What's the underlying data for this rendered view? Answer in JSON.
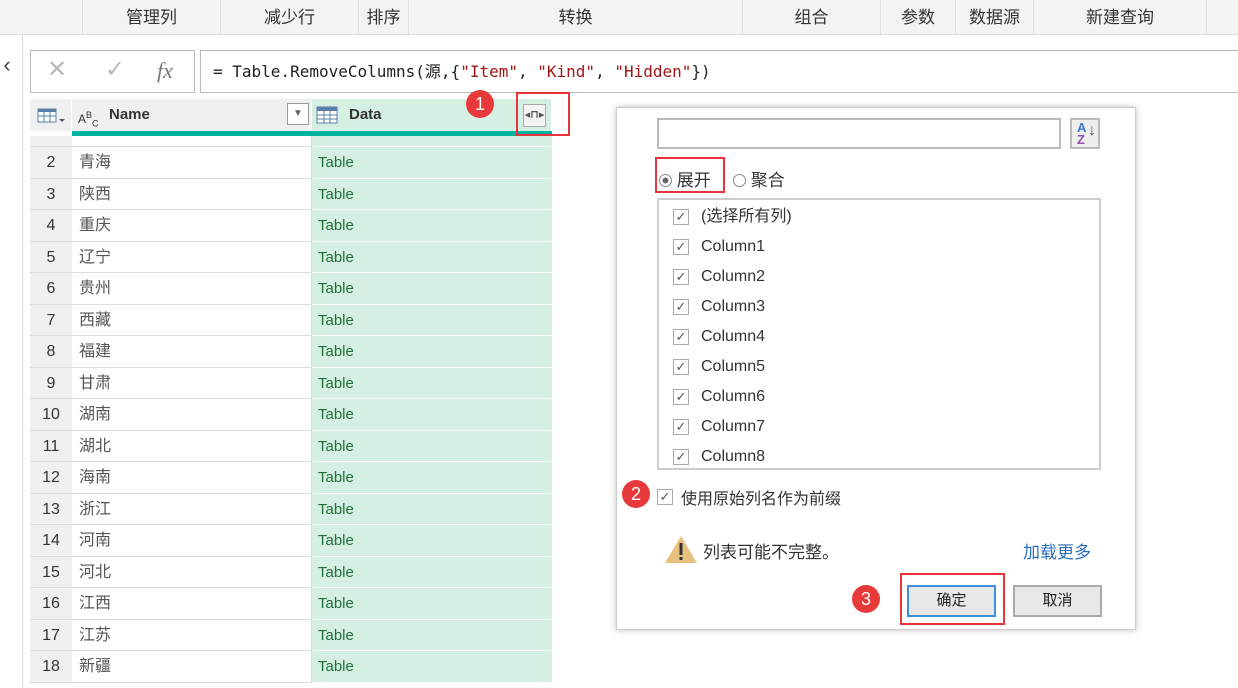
{
  "ribbon": {
    "groups": [
      "管理列",
      "减少行",
      "排序",
      "转换",
      "组合",
      "参数",
      "数据源",
      "新建查询"
    ]
  },
  "formula_bar": {
    "cancel_icon": "x-icon",
    "confirm_icon": "check-icon",
    "fx_label": "fx",
    "prefix": "= Table.RemoveColumns(源,{",
    "s1": "\"Item\"",
    "s2": "\"Kind\"",
    "s3": "\"Hidden\"",
    "sep": ", ",
    "suffix": "})"
  },
  "grid": {
    "columns": [
      {
        "label": "Name",
        "type": "ABC"
      },
      {
        "label": "Data",
        "type": "table"
      }
    ],
    "rows": [
      {
        "n": "2",
        "name": "青海",
        "data": "Table"
      },
      {
        "n": "3",
        "name": "陕西",
        "data": "Table"
      },
      {
        "n": "4",
        "name": "重庆",
        "data": "Table"
      },
      {
        "n": "5",
        "name": "辽宁",
        "data": "Table"
      },
      {
        "n": "6",
        "name": "贵州",
        "data": "Table"
      },
      {
        "n": "7",
        "name": "西藏",
        "data": "Table"
      },
      {
        "n": "8",
        "name": "福建",
        "data": "Table"
      },
      {
        "n": "9",
        "name": "甘肃",
        "data": "Table"
      },
      {
        "n": "10",
        "name": "湖南",
        "data": "Table"
      },
      {
        "n": "11",
        "name": "湖北",
        "data": "Table"
      },
      {
        "n": "12",
        "name": "海南",
        "data": "Table"
      },
      {
        "n": "13",
        "name": "浙江",
        "data": "Table"
      },
      {
        "n": "14",
        "name": "河南",
        "data": "Table"
      },
      {
        "n": "15",
        "name": "河北",
        "data": "Table"
      },
      {
        "n": "16",
        "name": "江西",
        "data": "Table"
      },
      {
        "n": "17",
        "name": "江苏",
        "data": "Table"
      },
      {
        "n": "18",
        "name": "新疆",
        "data": "Table"
      }
    ]
  },
  "annotations": [
    "1",
    "2",
    "3"
  ],
  "dialog": {
    "search_value": "",
    "expand_label": "展开",
    "aggregate_label": "聚合",
    "mode": "expand",
    "columns": [
      {
        "label": "(选择所有列)",
        "checked": true
      },
      {
        "label": "Column1",
        "checked": true
      },
      {
        "label": "Column2",
        "checked": true
      },
      {
        "label": "Column3",
        "checked": true
      },
      {
        "label": "Column4",
        "checked": true
      },
      {
        "label": "Column5",
        "checked": true
      },
      {
        "label": "Column6",
        "checked": true
      },
      {
        "label": "Column7",
        "checked": true
      },
      {
        "label": "Column8",
        "checked": true
      }
    ],
    "prefix_label": "使用原始列名作为前缀",
    "prefix_checked": true,
    "warning": "列表可能不完整。",
    "load_more": "加载更多",
    "ok": "确定",
    "cancel": "取消"
  },
  "colors": {
    "accent_teal": "#00b39f",
    "annotation_red": "#e83a3a",
    "data_col_bg": "#d6efe3",
    "link_blue": "#2a6ebd"
  }
}
